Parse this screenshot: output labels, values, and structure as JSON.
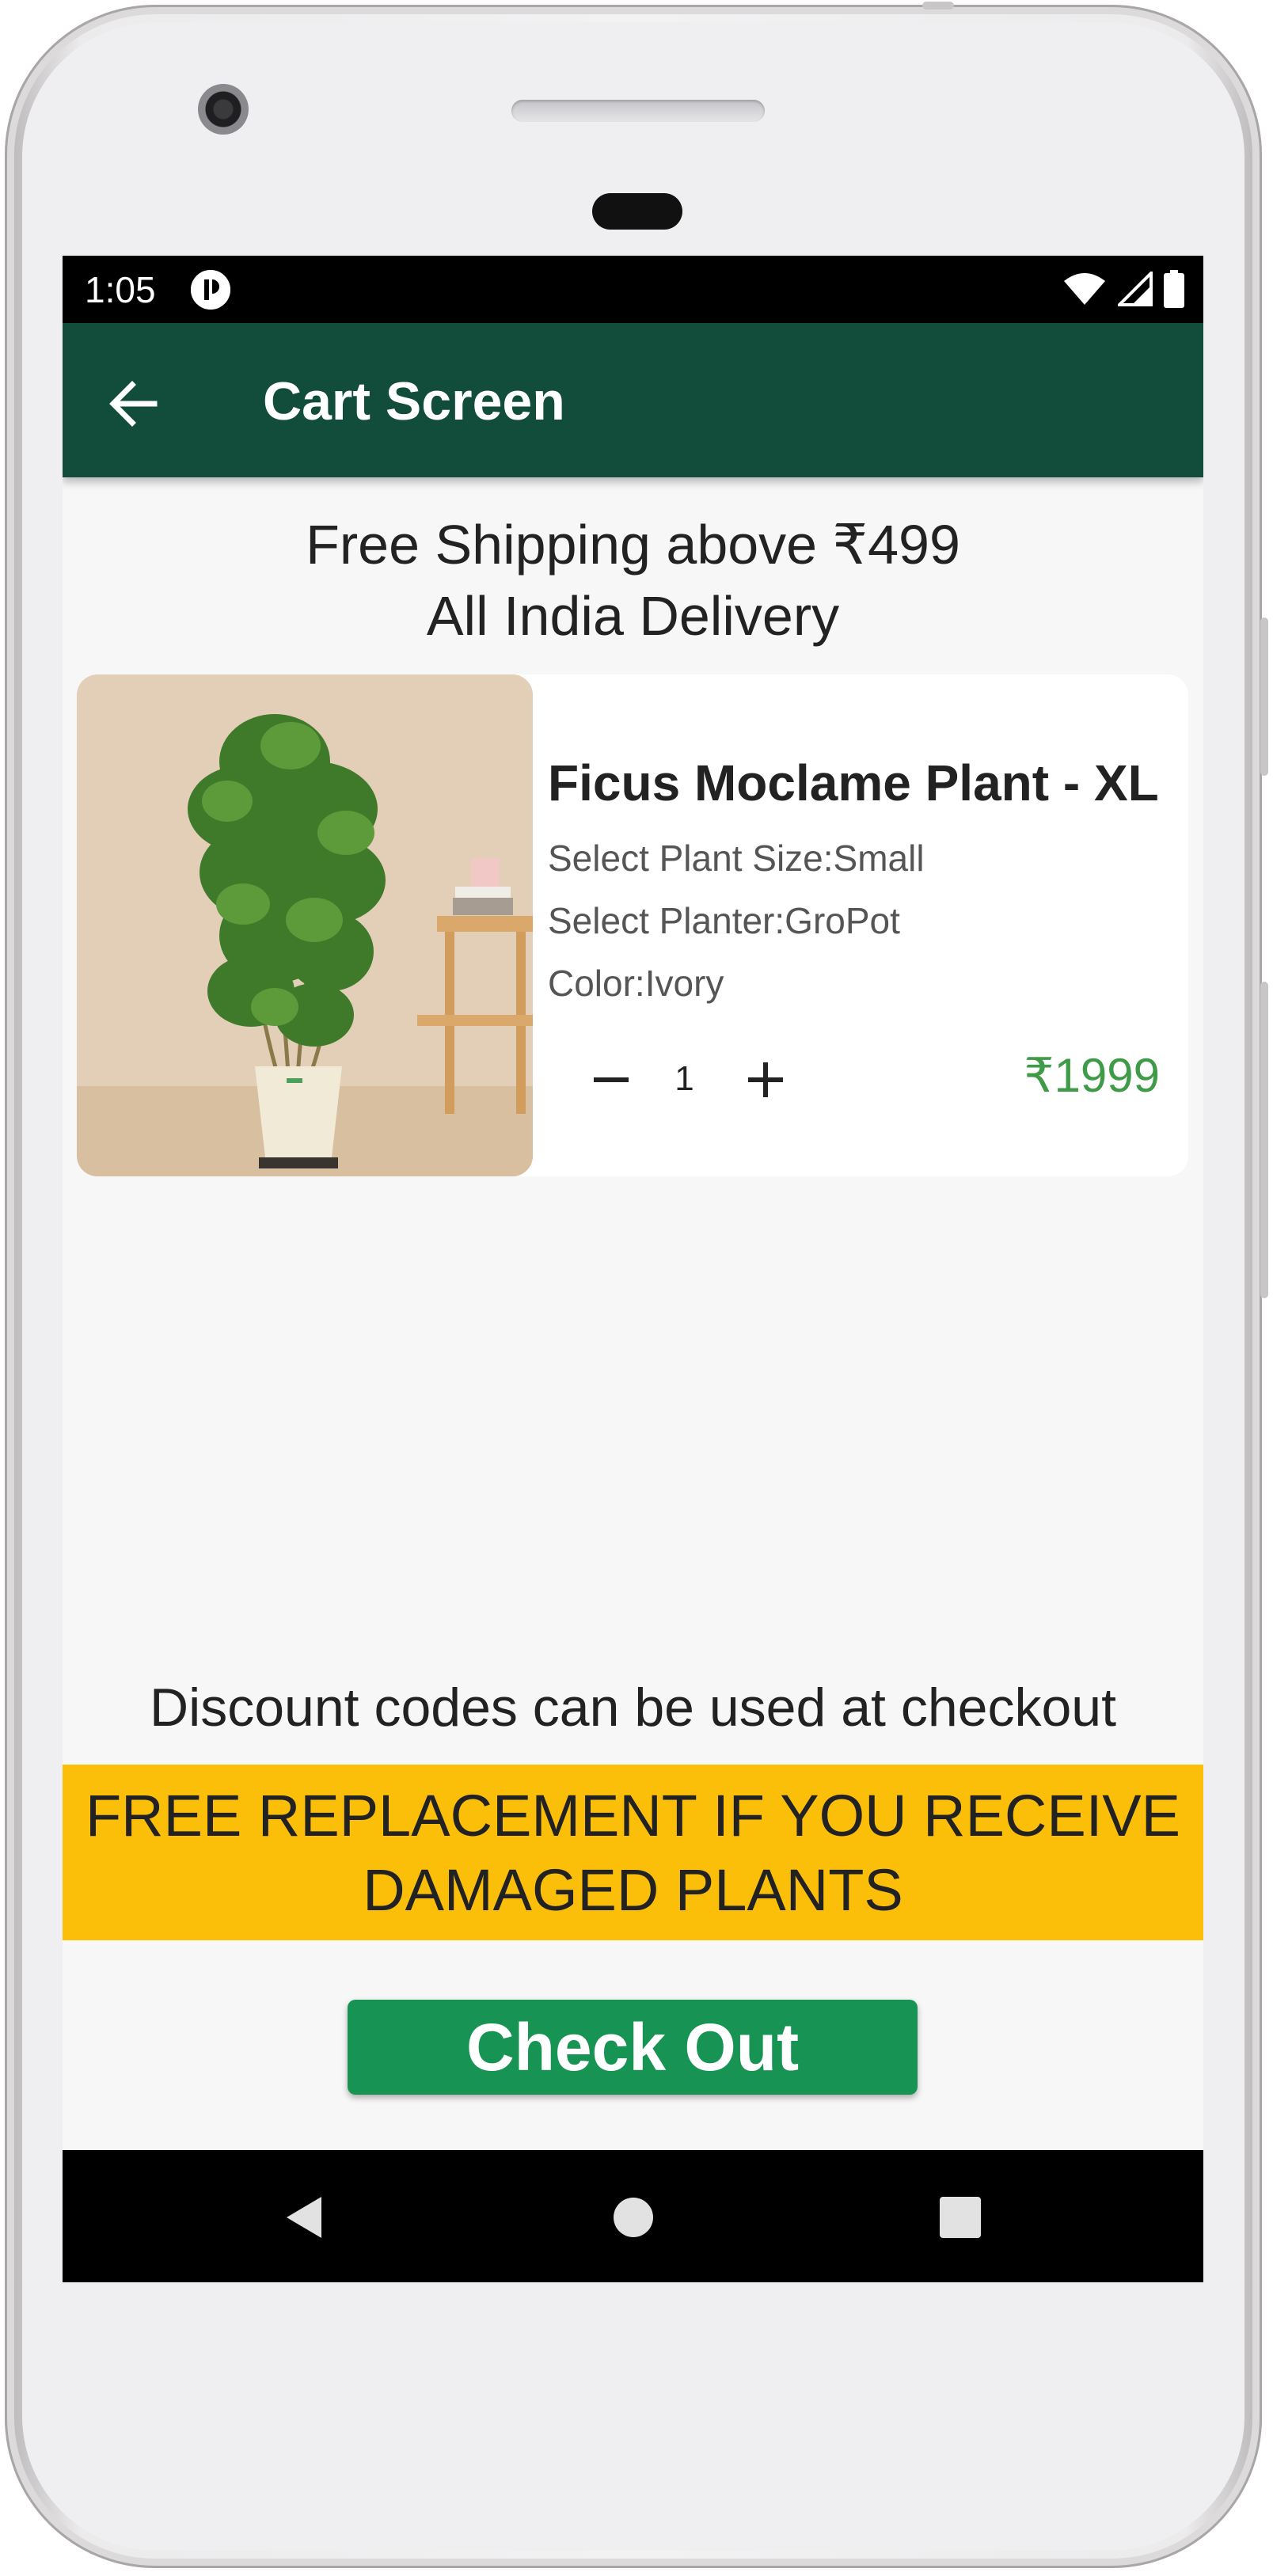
{
  "status_bar": {
    "time": "1:05"
  },
  "app_bar": {
    "title": "Cart Screen"
  },
  "shipping": {
    "line1": "Free Shipping above ₹499",
    "line2": "All India Delivery"
  },
  "cart_item": {
    "name": "Ficus Moclame Plant - XL",
    "size": "Select Plant Size:Small",
    "planter": "Select Planter:GroPot",
    "color": "Color:Ivory",
    "quantity": "1",
    "price": "₹1999"
  },
  "discount_note": "Discount codes can be used at checkout",
  "banner": {
    "line1": "FREE REPLACEMENT IF YOU RECEIVE",
    "line2": "DAMAGED PLANTS"
  },
  "checkout_label": "Check Out",
  "colors": {
    "app_bar": "#114d3a",
    "banner": "#fbbf09",
    "checkout": "#179453",
    "price": "#3f9b47"
  },
  "icons": [
    "back-arrow-icon",
    "wifi-icon",
    "signal-icon",
    "battery-icon",
    "minus-icon",
    "plus-icon",
    "nav-back-icon",
    "nav-home-icon",
    "nav-recents-icon"
  ]
}
